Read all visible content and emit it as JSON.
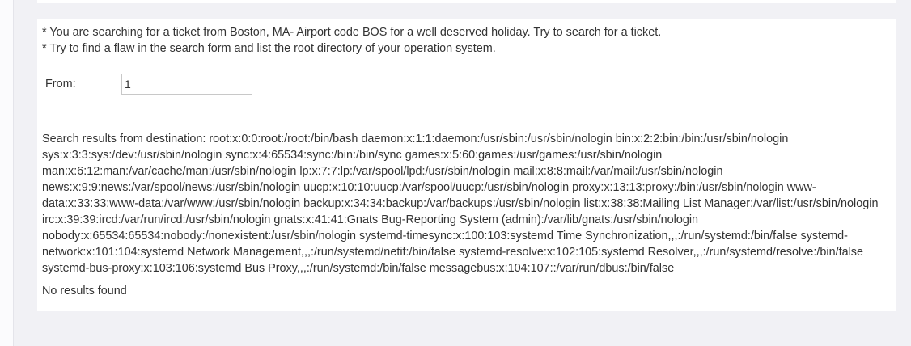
{
  "intro": {
    "line1": "* You are searching for a ticket from Boston, MA- Airport code BOS for a well deserved holiday. Try to search for a ticket.",
    "line2": "* Try to find a flaw in the search form and list the root directory of your operation system."
  },
  "form": {
    "from_label": "From:",
    "from_value": "1"
  },
  "results": {
    "text": "Search results from destination: root:x:0:0:root:/root:/bin/bash daemon:x:1:1:daemon:/usr/sbin:/usr/sbin/nologin bin:x:2:2:bin:/bin:/usr/sbin/nologin sys:x:3:3:sys:/dev:/usr/sbin/nologin sync:x:4:65534:sync:/bin:/bin/sync games:x:5:60:games:/usr/games:/usr/sbin/nologin man:x:6:12:man:/var/cache/man:/usr/sbin/nologin lp:x:7:7:lp:/var/spool/lpd:/usr/sbin/nologin mail:x:8:8:mail:/var/mail:/usr/sbin/nologin news:x:9:9:news:/var/spool/news:/usr/sbin/nologin uucp:x:10:10:uucp:/var/spool/uucp:/usr/sbin/nologin proxy:x:13:13:proxy:/bin:/usr/sbin/nologin www-data:x:33:33:www-data:/var/www:/usr/sbin/nologin backup:x:34:34:backup:/var/backups:/usr/sbin/nologin list:x:38:38:Mailing List Manager:/var/list:/usr/sbin/nologin irc:x:39:39:ircd:/var/run/ircd:/usr/sbin/nologin gnats:x:41:41:Gnats Bug-Reporting System (admin):/var/lib/gnats:/usr/sbin/nologin nobody:x:65534:65534:nobody:/nonexistent:/usr/sbin/nologin systemd-timesync:x:100:103:systemd Time Synchronization,,,:/run/systemd:/bin/false systemd-network:x:101:104:systemd Network Management,,,:/run/systemd/netif:/bin/false systemd-resolve:x:102:105:systemd Resolver,,,:/run/systemd/resolve:/bin/false systemd-bus-proxy:x:103:106:systemd Bus Proxy,,,:/run/systemd:/bin/false messagebus:x:104:107::/var/run/dbus:/bin/false",
    "no_results": "No results found"
  }
}
